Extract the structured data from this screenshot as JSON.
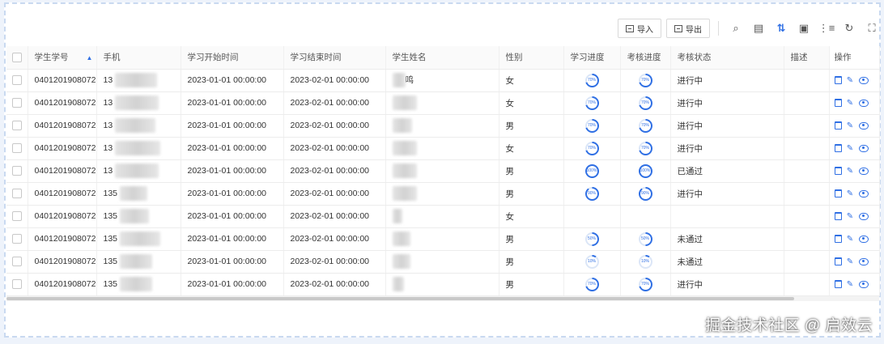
{
  "toolbar": {
    "import_label": "导入",
    "export_label": "导出"
  },
  "columns": [
    "学生学号",
    "手机",
    "学习开始时间",
    "学习结束时间",
    "学生姓名",
    "性别",
    "学习进度",
    "考核进度",
    "考核状态",
    "描述",
    "操作"
  ],
  "rows": [
    {
      "id": "0401201908072",
      "phone": "13",
      "start": "2023-01-01 00:00:00",
      "end": "2023-02-01 00:00:00",
      "name": "鸣",
      "gender": "女",
      "learn": "70%",
      "exam": "70%",
      "status": "进行中"
    },
    {
      "id": "0401201908072",
      "phone": "13",
      "start": "2023-01-01 00:00:00",
      "end": "2023-02-01 00:00:00",
      "name": "",
      "gender": "女",
      "learn": "70%",
      "exam": "70%",
      "status": "进行中"
    },
    {
      "id": "0401201908072",
      "phone": "13",
      "start": "2023-01-01 00:00:00",
      "end": "2023-02-01 00:00:00",
      "name": "",
      "gender": "男",
      "learn": "70%",
      "exam": "70%",
      "status": "进行中"
    },
    {
      "id": "0401201908072",
      "phone": "13",
      "start": "2023-01-01 00:00:00",
      "end": "2023-02-01 00:00:00",
      "name": "",
      "gender": "女",
      "learn": "70%",
      "exam": "70%",
      "status": "进行中"
    },
    {
      "id": "0401201908072",
      "phone": "13",
      "start": "2023-01-01 00:00:00",
      "end": "2023-02-01 00:00:00",
      "name": "",
      "gender": "男",
      "learn": "100%",
      "exam": "100%",
      "status": "已通过"
    },
    {
      "id": "0401201908072",
      "phone": "135",
      "start": "2023-01-01 00:00:00",
      "end": "2023-02-01 00:00:00",
      "name": "",
      "gender": "男",
      "learn": "90%",
      "exam": "90%",
      "status": "进行中"
    },
    {
      "id": "0401201908072",
      "phone": "135",
      "start": "2023-01-01 00:00:00",
      "end": "2023-02-01 00:00:00",
      "name": "",
      "gender": "女",
      "learn": "",
      "exam": "",
      "status": ""
    },
    {
      "id": "0401201908072",
      "phone": "135",
      "start": "2023-01-01 00:00:00",
      "end": "2023-02-01 00:00:00",
      "name": "",
      "gender": "男",
      "learn": "50%",
      "exam": "50%",
      "status": "未通过"
    },
    {
      "id": "0401201908072",
      "phone": "135",
      "start": "2023-01-01 00:00:00",
      "end": "2023-02-01 00:00:00",
      "name": "",
      "gender": "男",
      "learn": "10%",
      "exam": "10%",
      "status": "未通过"
    },
    {
      "id": "0401201908072",
      "phone": "135",
      "start": "2023-01-01 00:00:00",
      "end": "2023-02-01 00:00:00",
      "name": "",
      "gender": "男",
      "learn": "70%",
      "exam": "70%",
      "status": "进行中"
    }
  ],
  "watermark": "掘金技术社区 @ 启效云",
  "colors": {
    "accent": "#2f6fe4",
    "progress_track": "#dbe6f7"
  }
}
